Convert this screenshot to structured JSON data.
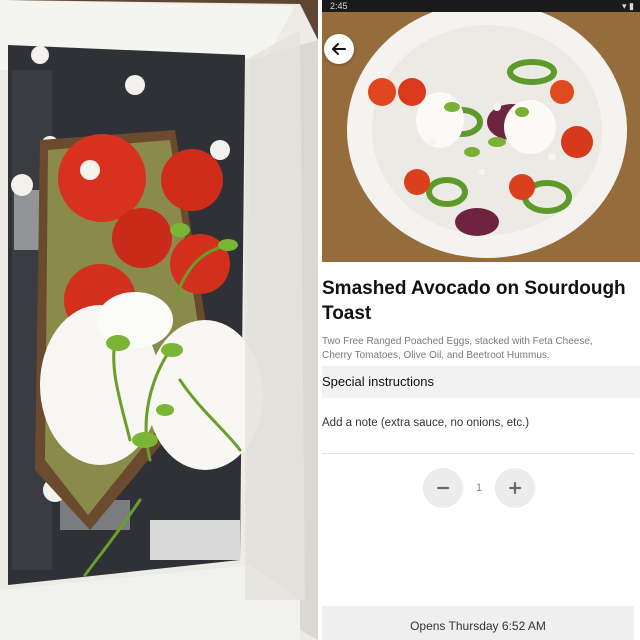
{
  "status_bar": {
    "time": "2:45"
  },
  "item": {
    "title": "Smashed Avocado on Sourdough Toast",
    "description": "Two Free Ranged Poached Eggs, stacked with Feta Cheese, Cherry Tomatoes, Olive Oil, and Beetroot Hummus."
  },
  "special_instructions": {
    "header": "Special instructions",
    "placeholder": "Add a note (extra sauce, no onions, etc.)"
  },
  "quantity": {
    "value": "1",
    "minus_icon": "minus-icon",
    "plus_icon": "plus-icon"
  },
  "footer": {
    "opens_label": "Opens Thursday 6:52 AM"
  },
  "icons": {
    "back": "arrow-left-icon"
  },
  "colors": {
    "primary_text": "#111111",
    "secondary_text": "#7a7a7a",
    "button_bg": "#ececec"
  }
}
